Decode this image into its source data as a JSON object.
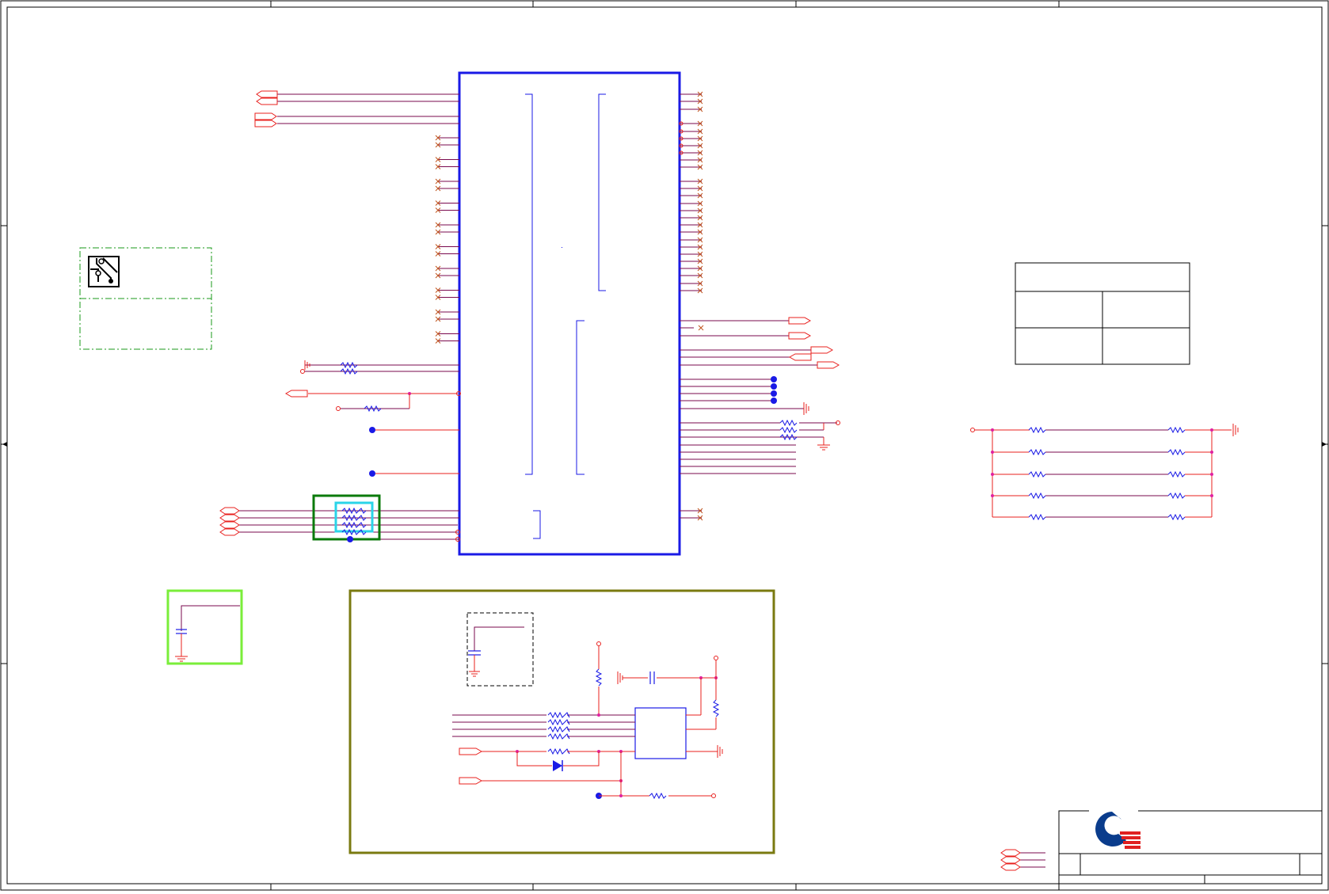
{
  "sheet": {
    "title": "",
    "background": "#ffffff",
    "colors": {
      "frame": "#000000",
      "wire": "#e8201e",
      "bus_line": "#7a0a4e",
      "component_outline": "#1a1ae6",
      "junction": "#1a1ae6",
      "power_port": "#e8201e",
      "no_connect": "#c0541e",
      "highlight_dark_green": "#0b7a0b",
      "highlight_cyan": "#2ad4e8",
      "highlight_lime": "#7aee3a",
      "highlight_olive": "#7a7a10",
      "dashed_box": "#1a9a1a",
      "logo_blue": "#0a3c8c",
      "logo_red": "#e02020"
    },
    "icons": [
      "pcb-trace-icon",
      "company-logo-icon"
    ],
    "grid_border": true,
    "title_block": true
  }
}
